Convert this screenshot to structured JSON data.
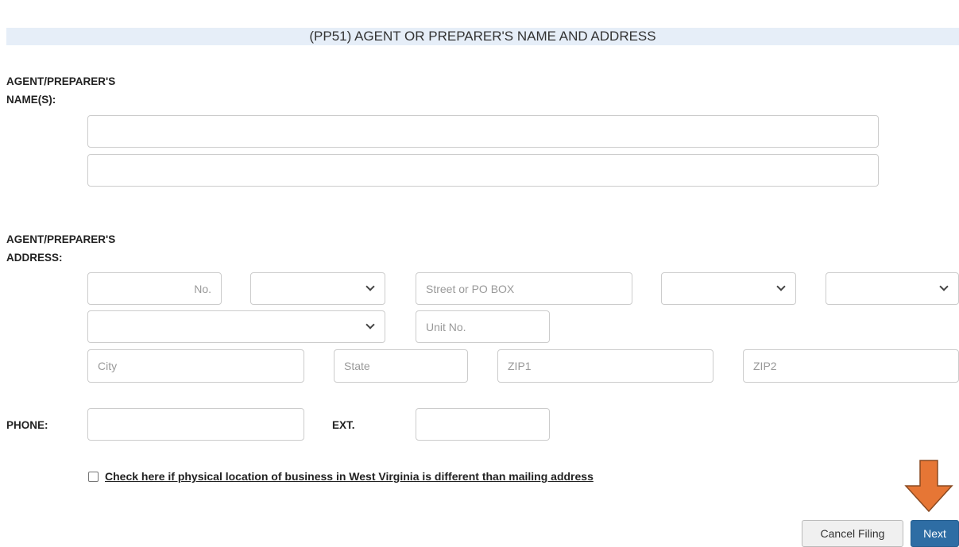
{
  "section": {
    "title": "(PP51) AGENT OR PREPARER'S NAME AND ADDRESS"
  },
  "names": {
    "label_line1": "AGENT/PREPARER'S",
    "label_line2": "NAME(S):",
    "name1_value": "",
    "name2_value": ""
  },
  "address": {
    "label_line1": "AGENT/PREPARER'S",
    "label_line2": "ADDRESS:",
    "number_placeholder": "No.",
    "direction_selected": "",
    "street_placeholder": "Street or PO BOX",
    "street_type_selected": "",
    "post_direction_selected": "",
    "unit_type_selected": "",
    "unit_placeholder": "Unit No.",
    "city_placeholder": "City",
    "state_placeholder": "State",
    "zip1_placeholder": "ZIP1",
    "zip2_placeholder": "ZIP2"
  },
  "phone": {
    "label": "PHONE:",
    "ext_label": "EXT.",
    "phone_value": "",
    "ext_value": ""
  },
  "physical_location": {
    "checked": false,
    "label": "Check here if physical location of business in West Virginia is different than mailing address"
  },
  "buttons": {
    "cancel_label": "Cancel Filing",
    "next_label": "Next"
  },
  "colors": {
    "header_bg": "#e6eef8",
    "next_button": "#2e6da4",
    "annotation_arrow": "#e67635"
  },
  "icons": {
    "annotation": "down-arrow-icon",
    "select": "chevron-down-icon"
  }
}
